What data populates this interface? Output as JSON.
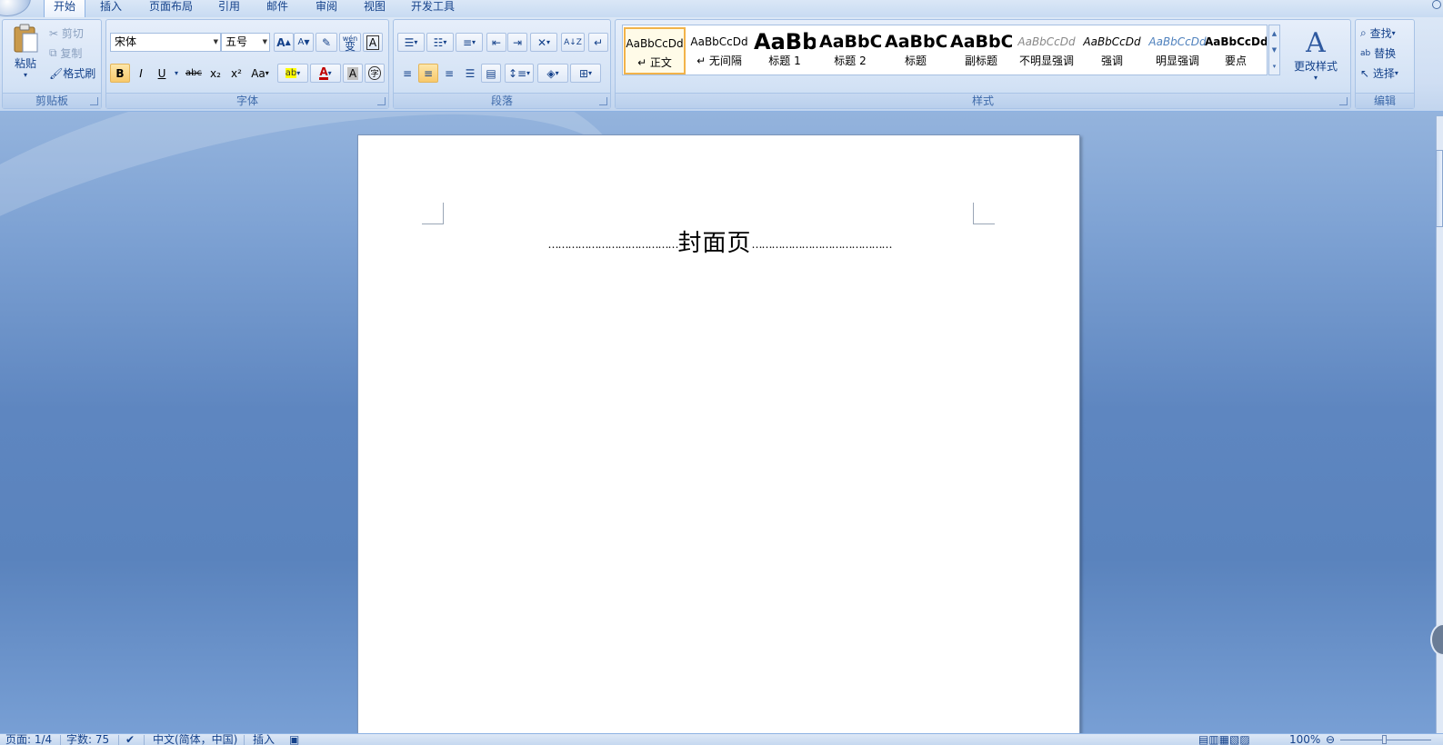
{
  "tabs": [
    "开始",
    "插入",
    "页面布局",
    "引用",
    "邮件",
    "审阅",
    "视图",
    "开发工具"
  ],
  "clipboard": {
    "paste": "粘贴",
    "cut": "剪切",
    "copy": "复制",
    "painter": "格式刷",
    "label": "剪贴板"
  },
  "font": {
    "name": "宋体",
    "size": "五号",
    "label": "字体",
    "grow": "A",
    "shrink": "A",
    "bold": "B",
    "italic": "I",
    "underline": "U",
    "strike": "abc",
    "sub": "x₂",
    "sup": "x²",
    "case": "Aa",
    "wen": "wén",
    "bian": "变",
    "char_border": "A",
    "color_a": "A",
    "shade_a": "A",
    "enclose": "字"
  },
  "paragraph": {
    "label": "段落"
  },
  "styles": {
    "label": "样式",
    "items": [
      {
        "preview": "AaBbCcDd",
        "name": "↵ 正文"
      },
      {
        "preview": "AaBbCcDd",
        "name": "↵ 无间隔"
      },
      {
        "preview": "AaBb",
        "name": "标题 1"
      },
      {
        "preview": "AaBbC",
        "name": "标题 2"
      },
      {
        "preview": "AaBbC",
        "name": "标题"
      },
      {
        "preview": "AaBbC",
        "name": "副标题"
      },
      {
        "preview": "AaBbCcDd",
        "name": "不明显强调"
      },
      {
        "preview": "AaBbCcDd",
        "name": "强调"
      },
      {
        "preview": "AaBbCcDd",
        "name": "明显强调"
      },
      {
        "preview": "AaBbCcDd",
        "name": "要点"
      }
    ],
    "change": "更改样式"
  },
  "editing": {
    "find": "查找",
    "replace": "替换",
    "select": "选择",
    "label": "编辑"
  },
  "document": {
    "title": "封面页",
    "dots_left": "…………………………………",
    "dots_right": "……………………………………"
  },
  "status": {
    "page": "页面: 1/4",
    "words": "字数: 75",
    "lang": "中文(简体，中国)",
    "mode": "插入",
    "zoom": "100%"
  },
  "colors": {
    "accent": "#15428b",
    "selected_style": "#f2b34a"
  }
}
